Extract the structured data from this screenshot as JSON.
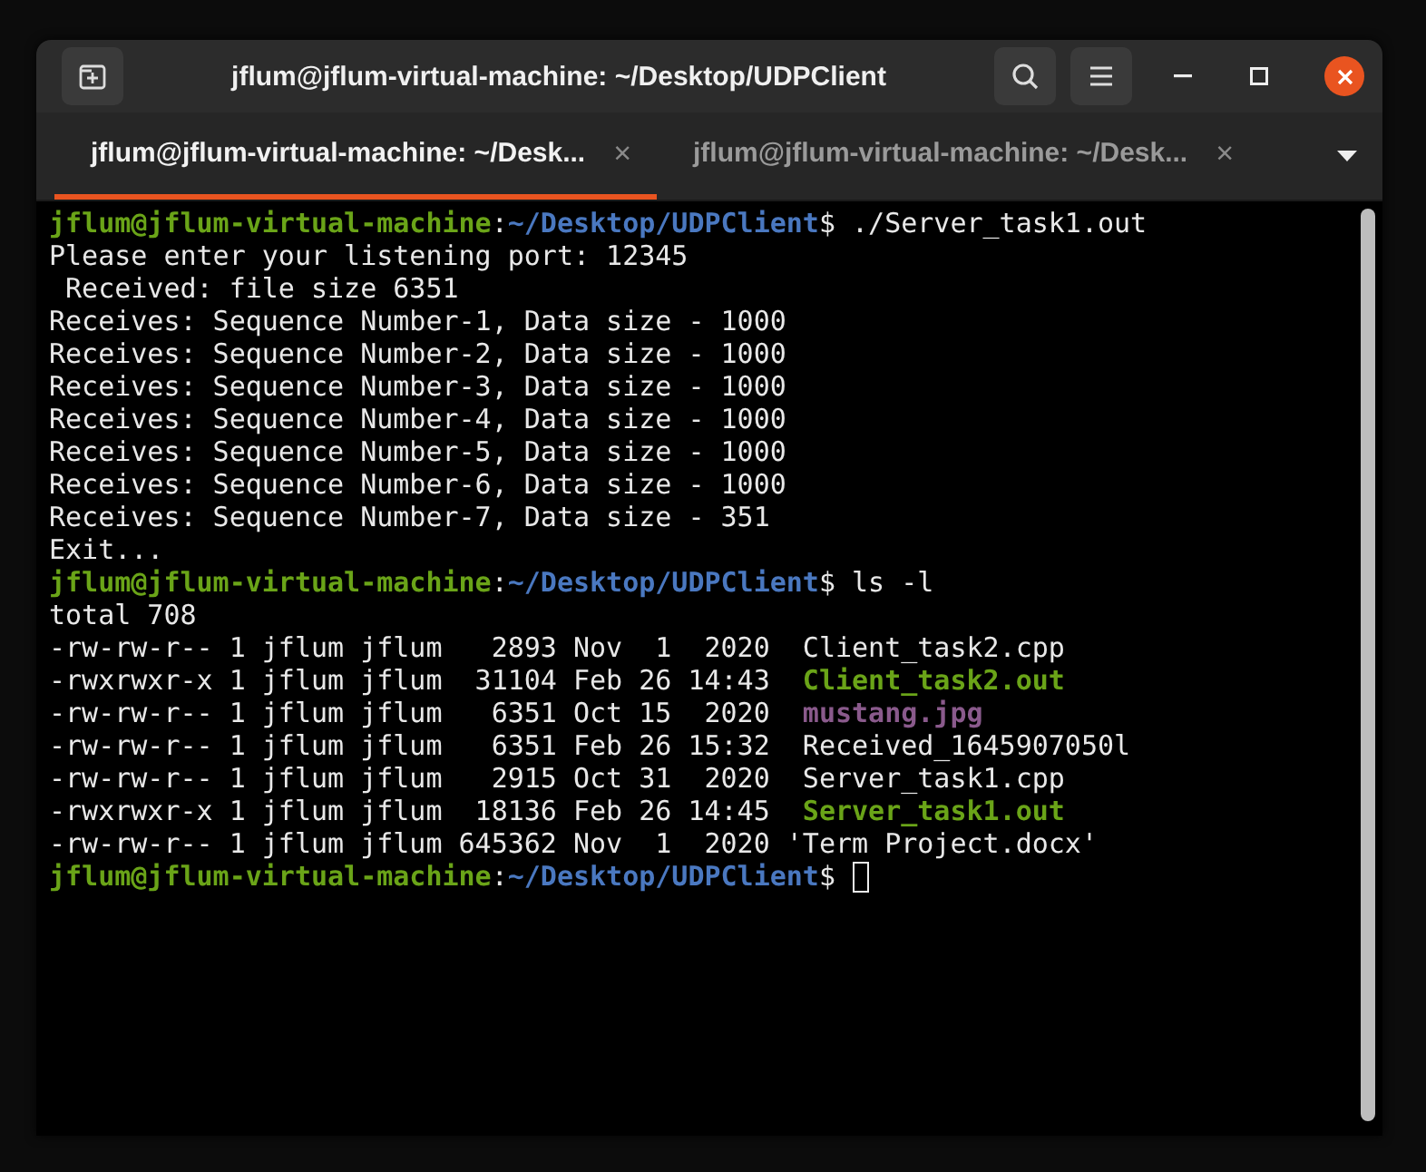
{
  "window": {
    "title": "jflum@jflum-virtual-machine: ~/Desktop/UDPClient"
  },
  "tabs": [
    {
      "label": "jflum@jflum-virtual-machine: ~/Desk...",
      "close": "×",
      "selected": true
    },
    {
      "label": "jflum@jflum-virtual-machine: ~/Desk...",
      "close": "×",
      "selected": false
    }
  ],
  "terminal": {
    "lines": [
      {
        "kind": "prompt",
        "user": "jflum@jflum-virtual-machine",
        "colon": ":",
        "path": "~/Desktop/UDPClient",
        "symbol": "$",
        "command": " ./Server_task1.out"
      },
      {
        "kind": "output",
        "text": "Please enter your listening port: 12345"
      },
      {
        "kind": "output",
        "text": " Received: file size 6351"
      },
      {
        "kind": "output",
        "text": "Receives: Sequence Number-1, Data size - 1000"
      },
      {
        "kind": "output",
        "text": "Receives: Sequence Number-2, Data size - 1000"
      },
      {
        "kind": "output",
        "text": "Receives: Sequence Number-3, Data size - 1000"
      },
      {
        "kind": "output",
        "text": "Receives: Sequence Number-4, Data size - 1000"
      },
      {
        "kind": "output",
        "text": "Receives: Sequence Number-5, Data size - 1000"
      },
      {
        "kind": "output",
        "text": "Receives: Sequence Number-6, Data size - 1000"
      },
      {
        "kind": "output",
        "text": "Receives: Sequence Number-7, Data size - 351"
      },
      {
        "kind": "output",
        "text": "Exit..."
      },
      {
        "kind": "prompt",
        "user": "jflum@jflum-virtual-machine",
        "colon": ":",
        "path": "~/Desktop/UDPClient",
        "symbol": "$",
        "command": " ls -l"
      },
      {
        "kind": "output",
        "text": "total 708"
      },
      {
        "kind": "listing",
        "meta": "-rw-rw-r-- 1 jflum jflum   2893 Nov  1  2020 ",
        "file": {
          "name": " Client_task2.cpp",
          "kind": "plain"
        }
      },
      {
        "kind": "listing",
        "meta": "-rwxrwxr-x 1 jflum jflum  31104 Feb 26 14:43 ",
        "file": {
          "name": " Client_task2.out",
          "kind": "executable"
        }
      },
      {
        "kind": "listing",
        "meta": "-rw-rw-r-- 1 jflum jflum   6351 Oct 15  2020 ",
        "file": {
          "name": " mustang.jpg",
          "kind": "image"
        }
      },
      {
        "kind": "listing",
        "meta": "-rw-rw-r-- 1 jflum jflum   6351 Feb 26 15:32 ",
        "file": {
          "name": " Received_1645907050l",
          "kind": "plain"
        }
      },
      {
        "kind": "listing",
        "meta": "-rw-rw-r-- 1 jflum jflum   2915 Oct 31  2020 ",
        "file": {
          "name": " Server_task1.cpp",
          "kind": "plain"
        }
      },
      {
        "kind": "listing",
        "meta": "-rwxrwxr-x 1 jflum jflum  18136 Feb 26 14:45 ",
        "file": {
          "name": " Server_task1.out",
          "kind": "executable"
        }
      },
      {
        "kind": "listing",
        "meta": "-rw-rw-r-- 1 jflum jflum 645362 Nov  1  2020 ",
        "file": {
          "name": "'Term Project.docx'",
          "kind": "plain"
        }
      },
      {
        "kind": "prompt",
        "user": "jflum@jflum-virtual-machine",
        "colon": ":",
        "path": "~/Desktop/UDPClient",
        "symbol": "$",
        "cursor": true
      }
    ]
  }
}
